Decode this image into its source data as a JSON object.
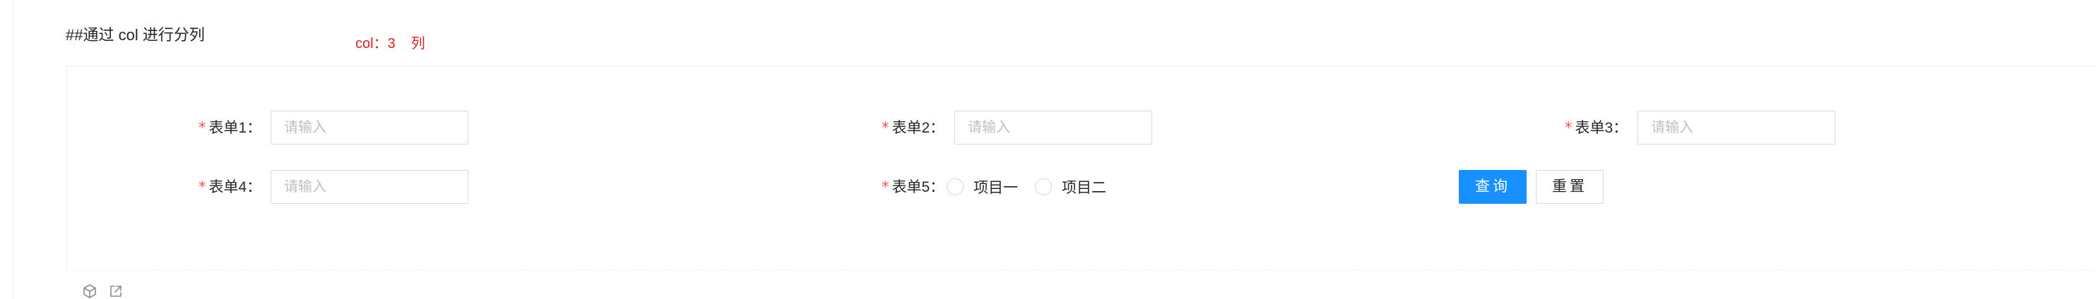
{
  "heading": "##通过 col 进行分列",
  "note": {
    "text": "col：3",
    "suffix": "列"
  },
  "form": {
    "required_mark": "*",
    "fields": [
      {
        "label": "表单1：",
        "placeholder": "请输入"
      },
      {
        "label": "表单2：",
        "placeholder": "请输入"
      },
      {
        "label": "表单3：",
        "placeholder": "请输入"
      },
      {
        "label": "表单4：",
        "placeholder": "请输入"
      }
    ],
    "radio_field": {
      "label": "表单5：",
      "options": [
        "项目一",
        "项目二"
      ]
    },
    "buttons": {
      "query": "查询",
      "reset": "重置"
    }
  },
  "footer_icons": [
    "codesandbox-icon",
    "external-link-icon"
  ],
  "colors": {
    "primary": "#1890ff",
    "required": "#ff4d4f",
    "note": "#e02020",
    "border": "#d9d9d9",
    "placeholder": "#bfbfbf"
  }
}
